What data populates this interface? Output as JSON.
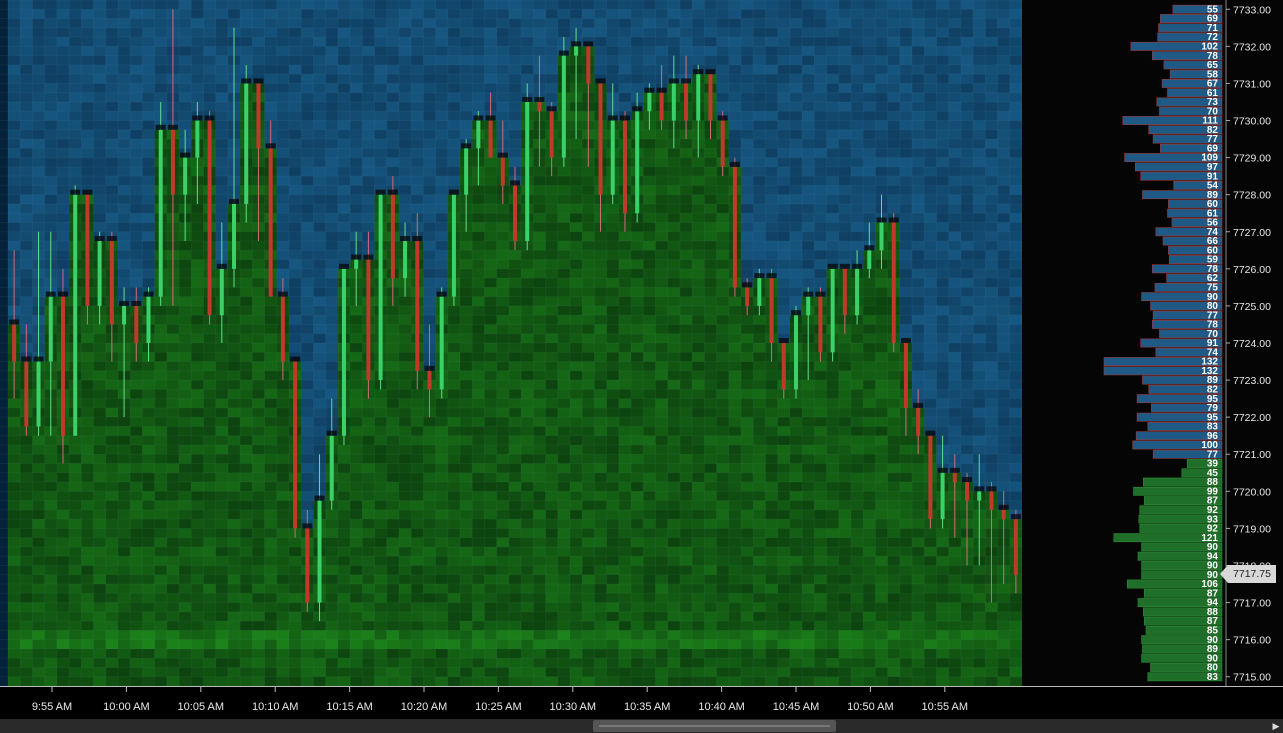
{
  "chart_data": {
    "type": "candlestick-heatmap",
    "title": "",
    "xlabel": "",
    "ylabel": "",
    "ylim": [
      7714.75,
      7733.25
    ],
    "tick_size": 0.25,
    "bid_ask_boundary": 7720.75,
    "last_price": 7717.75,
    "last_price_label": "7717.75",
    "price_axis_labels": [
      "7733.00",
      "7732.00",
      "7731.00",
      "7730.00",
      "7729.00",
      "7728.00",
      "7727.00",
      "7726.00",
      "7725.00",
      "7724.00",
      "7723.00",
      "7722.00",
      "7721.00",
      "7720.00",
      "7719.00",
      "7718.00",
      "7717.00",
      "7716.00",
      "7715.00"
    ],
    "time_axis_labels": [
      "9:55 AM",
      "10:00 AM",
      "10:05 AM",
      "10:10 AM",
      "10:15 AM",
      "10:20 AM",
      "10:25 AM",
      "10:30 AM",
      "10:35 AM",
      "10:40 AM",
      "10:45 AM",
      "10:50 AM",
      "10:55 AM"
    ],
    "candles": [
      {
        "o": 7724.5,
        "h": 7726.5,
        "l": 7722.5,
        "c": 7723.5
      },
      {
        "o": 7723.5,
        "h": 7724.5,
        "l": 7721.5,
        "c": 7721.75
      },
      {
        "o": 7721.75,
        "h": 7727.0,
        "l": 7721.5,
        "c": 7723.5
      },
      {
        "o": 7723.5,
        "h": 7727.0,
        "l": 7721.5,
        "c": 7725.25
      },
      {
        "o": 7725.25,
        "h": 7726.0,
        "l": 7720.75,
        "c": 7721.5
      },
      {
        "o": 7721.5,
        "h": 7728.25,
        "l": 7721.5,
        "c": 7728.0
      },
      {
        "o": 7728.0,
        "h": 7728.0,
        "l": 7724.5,
        "c": 7725.0
      },
      {
        "o": 7725.0,
        "h": 7727.0,
        "l": 7724.5,
        "c": 7726.75
      },
      {
        "o": 7726.75,
        "h": 7727.0,
        "l": 7723.5,
        "c": 7724.5
      },
      {
        "o": 7724.5,
        "h": 7725.5,
        "l": 7722.0,
        "c": 7725.0
      },
      {
        "o": 7725.0,
        "h": 7725.5,
        "l": 7723.5,
        "c": 7724.0
      },
      {
        "o": 7724.0,
        "h": 7725.5,
        "l": 7723.5,
        "c": 7725.25
      },
      {
        "o": 7725.25,
        "h": 7730.5,
        "l": 7725.0,
        "c": 7729.75
      },
      {
        "o": 7729.75,
        "h": 7733.0,
        "l": 7725.0,
        "c": 7728.0
      },
      {
        "o": 7728.0,
        "h": 7729.75,
        "l": 7726.75,
        "c": 7729.0
      },
      {
        "o": 7729.0,
        "h": 7730.5,
        "l": 7727.75,
        "c": 7730.0
      },
      {
        "o": 7730.0,
        "h": 7730.25,
        "l": 7724.5,
        "c": 7724.75
      },
      {
        "o": 7724.75,
        "h": 7727.25,
        "l": 7724.0,
        "c": 7726.0
      },
      {
        "o": 7726.0,
        "h": 7732.5,
        "l": 7725.5,
        "c": 7727.75
      },
      {
        "o": 7727.75,
        "h": 7731.5,
        "l": 7727.25,
        "c": 7731.0
      },
      {
        "o": 7731.0,
        "h": 7731.0,
        "l": 7726.75,
        "c": 7729.25
      },
      {
        "o": 7729.25,
        "h": 7730.0,
        "l": 7725.5,
        "c": 7725.25
      },
      {
        "o": 7725.25,
        "h": 7725.75,
        "l": 7723.0,
        "c": 7723.5
      },
      {
        "o": 7723.5,
        "h": 7723.5,
        "l": 7718.75,
        "c": 7719.0
      },
      {
        "o": 7719.0,
        "h": 7719.5,
        "l": 7716.75,
        "c": 7717.0
      },
      {
        "o": 7717.0,
        "h": 7721.0,
        "l": 7716.5,
        "c": 7719.75
      },
      {
        "o": 7719.75,
        "h": 7722.5,
        "l": 7719.5,
        "c": 7721.5
      },
      {
        "o": 7721.5,
        "h": 7726.0,
        "l": 7721.25,
        "c": 7726.0
      },
      {
        "o": 7726.0,
        "h": 7727.0,
        "l": 7725.0,
        "c": 7726.25
      },
      {
        "o": 7726.25,
        "h": 7727.0,
        "l": 7722.5,
        "c": 7723.0
      },
      {
        "o": 7723.0,
        "h": 7728.0,
        "l": 7722.75,
        "c": 7728.0
      },
      {
        "o": 7728.0,
        "h": 7728.5,
        "l": 7725.0,
        "c": 7725.75
      },
      {
        "o": 7725.75,
        "h": 7727.25,
        "l": 7725.25,
        "c": 7726.75
      },
      {
        "o": 7726.75,
        "h": 7727.5,
        "l": 7722.75,
        "c": 7723.25
      },
      {
        "o": 7723.25,
        "h": 7724.5,
        "l": 7722.0,
        "c": 7722.75
      },
      {
        "o": 7722.75,
        "h": 7725.5,
        "l": 7722.5,
        "c": 7725.25
      },
      {
        "o": 7725.25,
        "h": 7728.0,
        "l": 7725.0,
        "c": 7728.0
      },
      {
        "o": 7728.0,
        "h": 7729.5,
        "l": 7727.0,
        "c": 7729.25
      },
      {
        "o": 7729.25,
        "h": 7730.25,
        "l": 7728.25,
        "c": 7730.0
      },
      {
        "o": 7730.0,
        "h": 7730.75,
        "l": 7729.25,
        "c": 7729.0
      },
      {
        "o": 7729.0,
        "h": 7730.0,
        "l": 7727.75,
        "c": 7728.25
      },
      {
        "o": 7728.25,
        "h": 7728.75,
        "l": 7726.5,
        "c": 7726.75
      },
      {
        "o": 7726.75,
        "h": 7731.0,
        "l": 7726.5,
        "c": 7730.5
      },
      {
        "o": 7730.5,
        "h": 7731.75,
        "l": 7728.75,
        "c": 7730.25
      },
      {
        "o": 7730.25,
        "h": 7730.5,
        "l": 7728.5,
        "c": 7729.0
      },
      {
        "o": 7729.0,
        "h": 7732.25,
        "l": 7728.75,
        "c": 7731.75
      },
      {
        "o": 7731.75,
        "h": 7732.5,
        "l": 7729.5,
        "c": 7732.0
      },
      {
        "o": 7732.0,
        "h": 7732.0,
        "l": 7728.75,
        "c": 7731.0
      },
      {
        "o": 7731.0,
        "h": 7731.0,
        "l": 7727.0,
        "c": 7728.0
      },
      {
        "o": 7728.0,
        "h": 7731.0,
        "l": 7727.75,
        "c": 7730.0
      },
      {
        "o": 7730.0,
        "h": 7730.25,
        "l": 7727.0,
        "c": 7727.5
      },
      {
        "o": 7727.5,
        "h": 7730.75,
        "l": 7727.25,
        "c": 7730.25
      },
      {
        "o": 7730.25,
        "h": 7731.0,
        "l": 7729.75,
        "c": 7730.75
      },
      {
        "o": 7730.75,
        "h": 7731.5,
        "l": 7729.75,
        "c": 7730.0
      },
      {
        "o": 7730.0,
        "h": 7731.75,
        "l": 7729.25,
        "c": 7731.0
      },
      {
        "o": 7731.0,
        "h": 7731.75,
        "l": 7729.5,
        "c": 7730.0
      },
      {
        "o": 7730.0,
        "h": 7731.5,
        "l": 7729.0,
        "c": 7731.25
      },
      {
        "o": 7731.25,
        "h": 7731.25,
        "l": 7729.5,
        "c": 7730.0
      },
      {
        "o": 7730.0,
        "h": 7730.25,
        "l": 7728.5,
        "c": 7728.75
      },
      {
        "o": 7728.75,
        "h": 7729.0,
        "l": 7725.25,
        "c": 7725.5
      },
      {
        "o": 7725.5,
        "h": 7725.75,
        "l": 7724.75,
        "c": 7725.0
      },
      {
        "o": 7725.0,
        "h": 7726.0,
        "l": 7724.75,
        "c": 7725.75
      },
      {
        "o": 7725.75,
        "h": 7726.0,
        "l": 7723.5,
        "c": 7724.0
      },
      {
        "o": 7724.0,
        "h": 7724.0,
        "l": 7722.5,
        "c": 7722.75
      },
      {
        "o": 7722.75,
        "h": 7725.0,
        "l": 7722.5,
        "c": 7724.75
      },
      {
        "o": 7724.75,
        "h": 7725.5,
        "l": 7723.0,
        "c": 7725.25
      },
      {
        "o": 7725.25,
        "h": 7725.5,
        "l": 7723.5,
        "c": 7723.75
      },
      {
        "o": 7723.75,
        "h": 7726.0,
        "l": 7723.5,
        "c": 7726.0
      },
      {
        "o": 7726.0,
        "h": 7726.0,
        "l": 7724.25,
        "c": 7724.75
      },
      {
        "o": 7724.75,
        "h": 7726.5,
        "l": 7724.5,
        "c": 7726.0
      },
      {
        "o": 7726.0,
        "h": 7727.25,
        "l": 7725.75,
        "c": 7726.5
      },
      {
        "o": 7726.5,
        "h": 7728.0,
        "l": 7726.0,
        "c": 7727.25
      },
      {
        "o": 7727.25,
        "h": 7727.5,
        "l": 7723.75,
        "c": 7724.0
      },
      {
        "o": 7724.0,
        "h": 7724.0,
        "l": 7721.5,
        "c": 7722.25
      },
      {
        "o": 7722.25,
        "h": 7722.75,
        "l": 7721.0,
        "c": 7721.5
      },
      {
        "o": 7721.5,
        "h": 7721.5,
        "l": 7719.0,
        "c": 7719.25
      },
      {
        "o": 7719.25,
        "h": 7721.5,
        "l": 7719.0,
        "c": 7720.5
      },
      {
        "o": 7720.5,
        "h": 7721.0,
        "l": 7718.75,
        "c": 7720.25
      },
      {
        "o": 7720.25,
        "h": 7720.5,
        "l": 7718.0,
        "c": 7719.75
      },
      {
        "o": 7719.75,
        "h": 7721.0,
        "l": 7718.0,
        "c": 7720.0
      },
      {
        "o": 7720.0,
        "h": 7720.25,
        "l": 7717.0,
        "c": 7719.5
      },
      {
        "o": 7719.5,
        "h": 7720.0,
        "l": 7717.5,
        "c": 7719.25
      },
      {
        "o": 7719.25,
        "h": 7719.5,
        "l": 7717.25,
        "c": 7717.75
      }
    ],
    "volume_profile": [
      {
        "price": 7733.0,
        "volume": "55",
        "side": "ask"
      },
      {
        "price": 7732.75,
        "volume": "69",
        "side": "ask"
      },
      {
        "price": 7732.5,
        "volume": "71",
        "side": "ask"
      },
      {
        "price": 7732.25,
        "volume": "72",
        "side": "ask"
      },
      {
        "price": 7732.0,
        "volume": "102",
        "side": "ask"
      },
      {
        "price": 7731.75,
        "volume": "78",
        "side": "ask"
      },
      {
        "price": 7731.5,
        "volume": "65",
        "side": "ask"
      },
      {
        "price": 7731.25,
        "volume": "58",
        "side": "ask"
      },
      {
        "price": 7731.0,
        "volume": "67",
        "side": "ask"
      },
      {
        "price": 7730.75,
        "volume": "61",
        "side": "ask"
      },
      {
        "price": 7730.5,
        "volume": "73",
        "side": "ask"
      },
      {
        "price": 7730.25,
        "volume": "70",
        "side": "ask"
      },
      {
        "price": 7730.0,
        "volume": "111",
        "side": "ask"
      },
      {
        "price": 7729.75,
        "volume": "82",
        "side": "ask"
      },
      {
        "price": 7729.5,
        "volume": "77",
        "side": "ask"
      },
      {
        "price": 7729.25,
        "volume": "69",
        "side": "ask"
      },
      {
        "price": 7729.0,
        "volume": "109",
        "side": "ask"
      },
      {
        "price": 7728.75,
        "volume": "97",
        "side": "ask"
      },
      {
        "price": 7728.5,
        "volume": "91",
        "side": "ask"
      },
      {
        "price": 7728.25,
        "volume": "54",
        "side": "ask"
      },
      {
        "price": 7728.0,
        "volume": "89",
        "side": "ask"
      },
      {
        "price": 7727.75,
        "volume": "60",
        "side": "ask"
      },
      {
        "price": 7727.5,
        "volume": "61",
        "side": "ask"
      },
      {
        "price": 7727.25,
        "volume": "56",
        "side": "ask"
      },
      {
        "price": 7727.0,
        "volume": "74",
        "side": "ask"
      },
      {
        "price": 7726.75,
        "volume": "66",
        "side": "ask"
      },
      {
        "price": 7726.5,
        "volume": "60",
        "side": "ask"
      },
      {
        "price": 7726.25,
        "volume": "59",
        "side": "ask"
      },
      {
        "price": 7726.0,
        "volume": "78",
        "side": "ask"
      },
      {
        "price": 7725.75,
        "volume": "62",
        "side": "ask"
      },
      {
        "price": 7725.5,
        "volume": "75",
        "side": "ask"
      },
      {
        "price": 7725.25,
        "volume": "90",
        "side": "ask"
      },
      {
        "price": 7725.0,
        "volume": "80",
        "side": "ask"
      },
      {
        "price": 7724.75,
        "volume": "77",
        "side": "ask"
      },
      {
        "price": 7724.5,
        "volume": "78",
        "side": "ask"
      },
      {
        "price": 7724.25,
        "volume": "70",
        "side": "ask"
      },
      {
        "price": 7724.0,
        "volume": "91",
        "side": "ask"
      },
      {
        "price": 7723.75,
        "volume": "74",
        "side": "ask"
      },
      {
        "price": 7723.5,
        "volume": "132",
        "side": "ask"
      },
      {
        "price": 7723.25,
        "volume": "132",
        "side": "ask"
      },
      {
        "price": 7723.0,
        "volume": "89",
        "side": "ask"
      },
      {
        "price": 7722.75,
        "volume": "82",
        "side": "ask"
      },
      {
        "price": 7722.5,
        "volume": "95",
        "side": "ask"
      },
      {
        "price": 7722.25,
        "volume": "79",
        "side": "ask"
      },
      {
        "price": 7722.0,
        "volume": "95",
        "side": "ask"
      },
      {
        "price": 7721.75,
        "volume": "83",
        "side": "ask"
      },
      {
        "price": 7721.5,
        "volume": "96",
        "side": "ask"
      },
      {
        "price": 7721.25,
        "volume": "100",
        "side": "ask"
      },
      {
        "price": 7721.0,
        "volume": "77",
        "side": "ask"
      },
      {
        "price": 7720.75,
        "volume": "39",
        "side": "bid"
      },
      {
        "price": 7720.5,
        "volume": "45",
        "side": "bid"
      },
      {
        "price": 7720.25,
        "volume": "88",
        "side": "bid"
      },
      {
        "price": 7720.0,
        "volume": "99",
        "side": "bid"
      },
      {
        "price": 7719.75,
        "volume": "87",
        "side": "bid"
      },
      {
        "price": 7719.5,
        "volume": "92",
        "side": "bid"
      },
      {
        "price": 7719.25,
        "volume": "93",
        "side": "bid"
      },
      {
        "price": 7719.0,
        "volume": "92",
        "side": "bid"
      },
      {
        "price": 7718.75,
        "volume": "121",
        "side": "bid"
      },
      {
        "price": 7718.5,
        "volume": "90",
        "side": "bid"
      },
      {
        "price": 7718.25,
        "volume": "94",
        "side": "bid"
      },
      {
        "price": 7718.0,
        "volume": "90",
        "side": "bid"
      },
      {
        "price": 7717.75,
        "volume": "90",
        "side": "bid"
      },
      {
        "price": 7717.5,
        "volume": "106",
        "side": "bid"
      },
      {
        "price": 7717.25,
        "volume": "87",
        "side": "bid"
      },
      {
        "price": 7717.0,
        "volume": "94",
        "side": "bid"
      },
      {
        "price": 7716.75,
        "volume": "88",
        "side": "bid"
      },
      {
        "price": 7716.5,
        "volume": "87",
        "side": "bid"
      },
      {
        "price": 7716.25,
        "volume": "85",
        "side": "bid"
      },
      {
        "price": 7716.0,
        "volume": "90",
        "side": "bid"
      },
      {
        "price": 7715.75,
        "volume": "89",
        "side": "bid"
      },
      {
        "price": 7715.5,
        "volume": "90",
        "side": "bid"
      },
      {
        "price": 7715.25,
        "volume": "80",
        "side": "bid"
      },
      {
        "price": 7715.0,
        "volume": "83",
        "side": "bid"
      }
    ],
    "colors": {
      "background": "#000000",
      "ask_heat": "#0d3a5c",
      "bid_heat": "#0f4a14",
      "up_candle": "#3ad16a",
      "down_candle": "#c0392b",
      "ask_bar": "#1e5a85",
      "bid_bar": "#1f6e2a"
    }
  }
}
